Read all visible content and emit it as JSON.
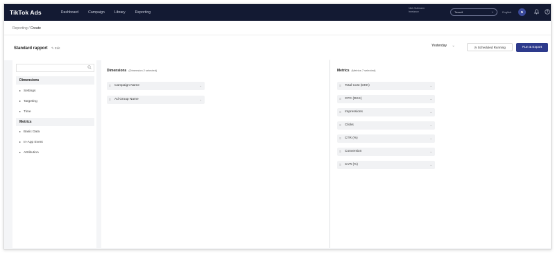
{
  "nav": {
    "logo": "TikTok Ads",
    "links": [
      "Dashboard",
      "Campaign",
      "Library",
      "Reporting"
    ],
    "account_name": "Nick Sullmann",
    "account_sub": "freelance",
    "account_select": "Tassell",
    "language": "English",
    "avatar_initial": "N"
  },
  "breadcrumb": {
    "parent": "Reporting",
    "separator": "/",
    "current": "Create"
  },
  "report": {
    "title": "Standard rapport",
    "edit_label": "Edit",
    "date_range": "Yesterday",
    "scheduled_label": "Scheduled Running",
    "run_label": "Run & Export"
  },
  "sidebar": {
    "search_placeholder": "",
    "dimensions_heading": "Dimensions",
    "dimension_items": [
      "Settings",
      "Targeting",
      "Time"
    ],
    "metrics_heading": "Metrics",
    "metric_items": [
      "Basic Data",
      "In-App Event",
      "Attribution"
    ]
  },
  "dimensions_panel": {
    "title": "Dimensions",
    "subtitle": "(Dimension 2 selected)",
    "chips": [
      "Campaign Name",
      "Ad Group Name"
    ]
  },
  "metrics_panel": {
    "title": "Metrics",
    "subtitle": "(Metrics 7 selected)",
    "chips": [
      "Total Cost (DKK)",
      "CPC (DKK)",
      "Impressions",
      "Clicks",
      "CTR (%)",
      "Conversion",
      "CVR (%)"
    ]
  },
  "colors": {
    "nav_bg": "#131a33",
    "primary_button": "#2d3a8c",
    "avatar": "#3b4a9b"
  }
}
